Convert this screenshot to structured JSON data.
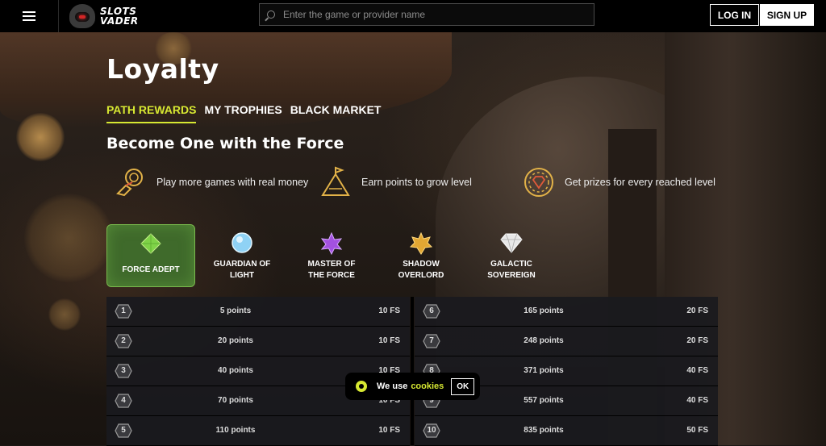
{
  "header": {
    "logo_line1": "SLOTS",
    "logo_line2": "VADER",
    "search_placeholder": "Enter the game or provider name",
    "login_label": "LOG IN",
    "signup_label": "SIGN UP"
  },
  "page": {
    "title": "Loyalty",
    "tabs": [
      {
        "label": "PATH REWARDS",
        "active": true
      },
      {
        "label": "MY TROPHIES",
        "active": false
      },
      {
        "label": "BLACK MARKET",
        "active": false
      }
    ],
    "subtitle": "Become One with the Force"
  },
  "features": [
    {
      "icon": "hand-coin-icon",
      "text": "Play more games with real money"
    },
    {
      "icon": "flag-mountain-icon",
      "text": "Earn points to grow level"
    },
    {
      "icon": "diamond-chip-icon",
      "text": "Get prizes for every reached level"
    }
  ],
  "levels": [
    {
      "icon": "green-gem-icon",
      "line1": "FORCE ADEPT",
      "line2": "",
      "active": true,
      "color": "#7fd348"
    },
    {
      "icon": "blue-orb-icon",
      "line1": "GUARDIAN OF",
      "line2": "LIGHT",
      "active": false,
      "color": "#8fd2f5"
    },
    {
      "icon": "purple-star-icon",
      "line1": "MASTER OF",
      "line2": "THE FORCE",
      "active": false,
      "color": "#a351e0"
    },
    {
      "icon": "gold-star-icon",
      "line1": "SHADOW",
      "line2": "OVERLORD",
      "active": false,
      "color": "#e2a733"
    },
    {
      "icon": "white-diamond-icon",
      "line1": "GALACTIC",
      "line2": "SOVEREIGN",
      "active": false,
      "color": "#e8e8e8"
    }
  ],
  "rewards_left": [
    {
      "level": "1",
      "points": "5 points",
      "fs": "10 FS"
    },
    {
      "level": "2",
      "points": "20 points",
      "fs": "10 FS"
    },
    {
      "level": "3",
      "points": "40 points",
      "fs": "10 FS"
    },
    {
      "level": "4",
      "points": "70 points",
      "fs": "10 FS"
    },
    {
      "level": "5",
      "points": "110 points",
      "fs": "10 FS"
    }
  ],
  "rewards_right": [
    {
      "level": "6",
      "points": "165 points",
      "fs": "20 FS"
    },
    {
      "level": "7",
      "points": "248 points",
      "fs": "20 FS"
    },
    {
      "level": "8",
      "points": "371 points",
      "fs": "40 FS"
    },
    {
      "level": "9",
      "points": "557 points",
      "fs": "40 FS"
    },
    {
      "level": "10",
      "points": "835 points",
      "fs": "50 FS"
    }
  ],
  "cookie": {
    "text": "We use",
    "link": "cookies",
    "ok": "OK"
  },
  "colors": {
    "accent": "#d7e832",
    "active_level_bg": "#3f6a2b"
  }
}
